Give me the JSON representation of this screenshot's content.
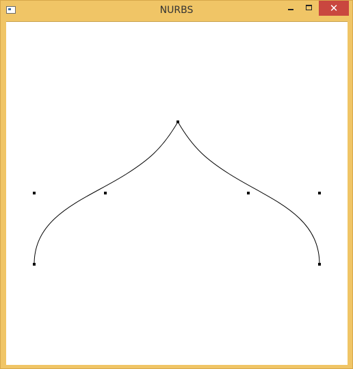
{
  "window": {
    "title": "NURBS",
    "icons": {
      "app": "window-app-icon",
      "minimize": "minimize-icon",
      "maximize": "maximize-icon",
      "close": "close-icon"
    },
    "colors": {
      "frame": "#f0c566",
      "close_button": "#c9473f",
      "canvas": "#ffffff",
      "curve": "#000000",
      "control_point": "#000000"
    }
  },
  "close_glyph": "✕"
}
